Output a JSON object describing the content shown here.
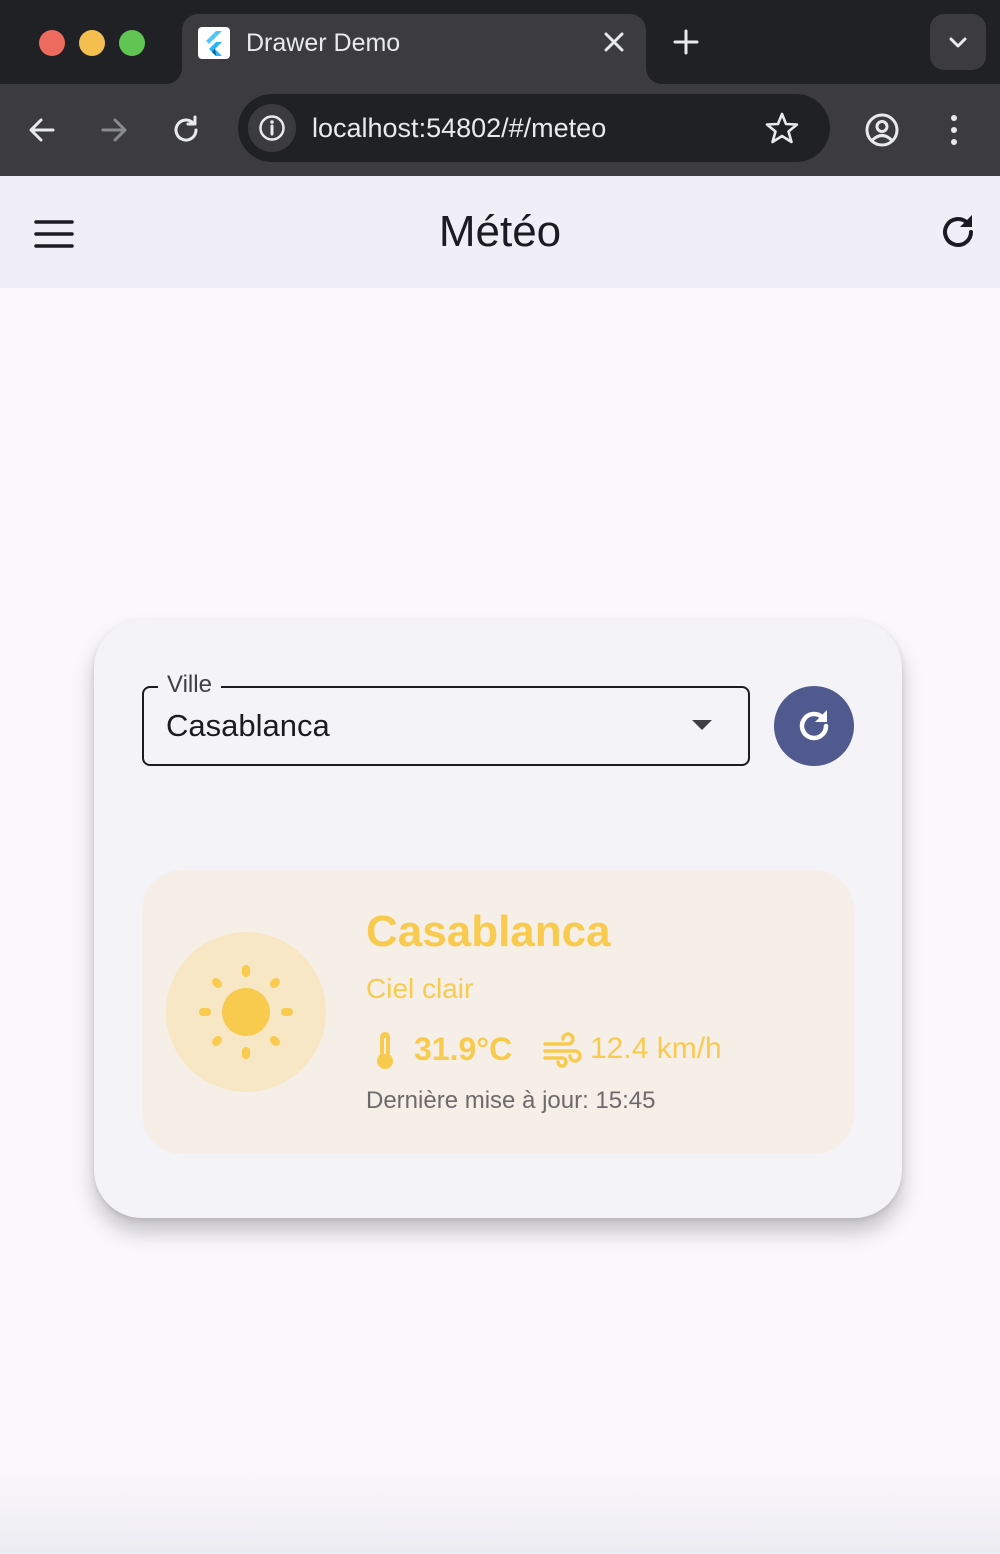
{
  "browser": {
    "tab_title": "Drawer Demo",
    "url": "localhost:54802/#/meteo"
  },
  "appbar": {
    "title": "Météo"
  },
  "form": {
    "city_label": "Ville",
    "city_value": "Casablanca"
  },
  "weather": {
    "city": "Casablanca",
    "description": "Ciel clair",
    "temperature": "31.9°C",
    "wind": "12.4 km/h",
    "updated": "Dernière mise à jour: 15:45",
    "icon": "sun-icon",
    "accent_color": "#f8cb4f"
  },
  "colors": {
    "fab": "#515a8e",
    "appbar": "#f0eff7",
    "weather_card": "#f6efe7"
  }
}
